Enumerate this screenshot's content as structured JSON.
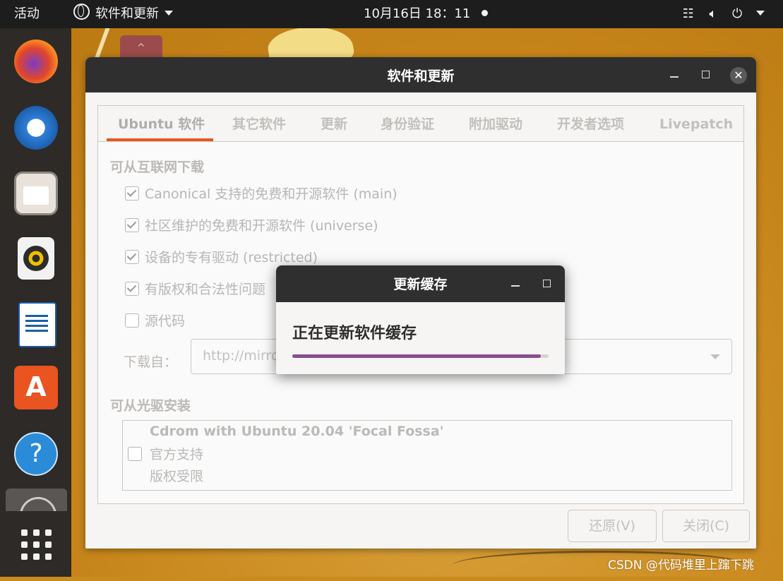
{
  "top_bar": {
    "activities": "活动",
    "app_menu_label": "软件和更新",
    "clock": "10月16日  18：11",
    "tray_icons": [
      "network-icon",
      "volume-icon",
      "power-icon",
      "chevron-down-icon"
    ]
  },
  "dock": {
    "apps": [
      "firefox",
      "thunderbird",
      "files",
      "rhythmbox",
      "libreoffice-writer",
      "ubuntu-software",
      "help",
      "software-properties"
    ],
    "software_glyph": "A",
    "help_glyph": "?"
  },
  "main_window": {
    "title": "软件和更新",
    "tabs": [
      {
        "label": "Ubuntu 软件",
        "active": true
      },
      {
        "label": "其它软件"
      },
      {
        "label": "更新"
      },
      {
        "label": "身份验证"
      },
      {
        "label": "附加驱动"
      },
      {
        "label": "开发者选项"
      },
      {
        "label": "Livepatch"
      }
    ],
    "internet_section": {
      "title": "可从互联网下载",
      "options": [
        {
          "label": "Canonical 支持的免费和开源软件 (main)",
          "checked": true
        },
        {
          "label": "社区维护的免费和开源软件 (universe)",
          "checked": true
        },
        {
          "label": "设备的专有驱动 (restricted)",
          "checked": true
        },
        {
          "label": "有版权和合法性问题",
          "checked": true
        },
        {
          "label": "源代码",
          "checked": false
        }
      ],
      "download_from_label": "下载自：",
      "mirror_value": "http://mirro"
    },
    "cdrom_section": {
      "title": "可从光驱安装",
      "cdrom_name": "Cdrom with Ubuntu 20.04 'Focal Fossa'",
      "line2": "官方支持",
      "line3": "版权受限",
      "checked": false
    },
    "buttons": {
      "revert": "还原(V)",
      "close": "关闭(C)"
    }
  },
  "dialog": {
    "title": "更新缓存",
    "message": "正在更新软件缓存",
    "progress": 0.97,
    "progress_color": "#8a4e8f"
  },
  "watermark": "CSDN @代码堆里上蹿下跳"
}
